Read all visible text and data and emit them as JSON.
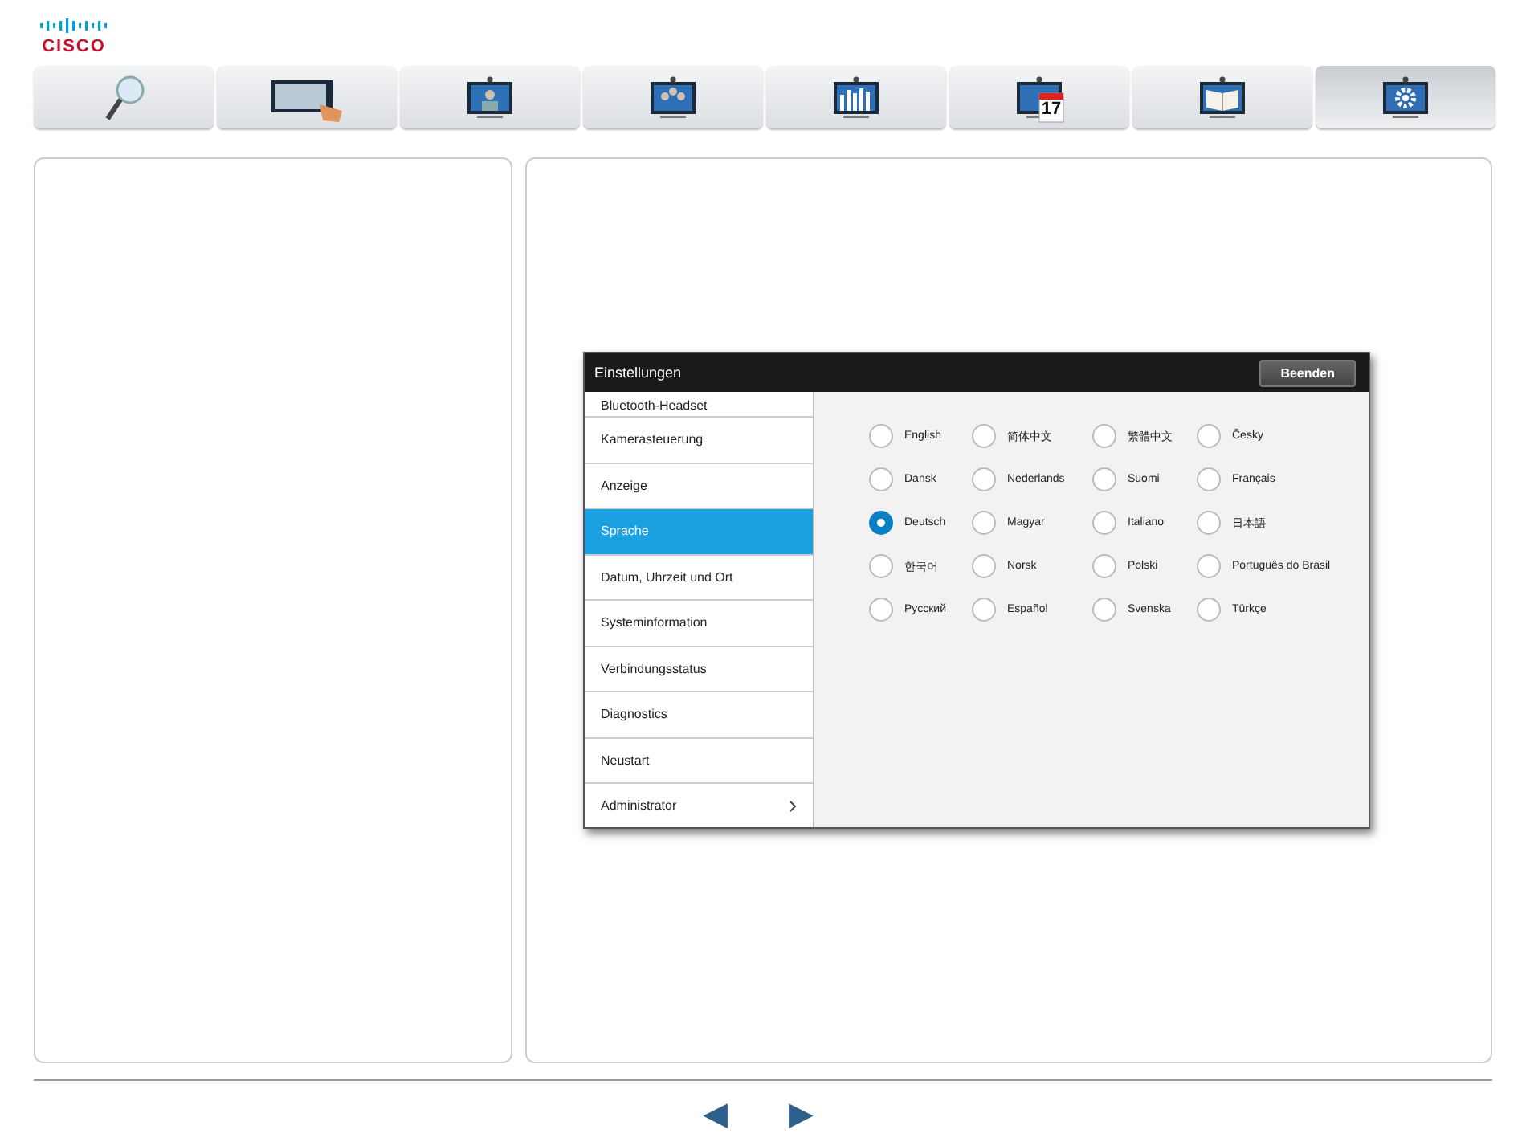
{
  "logo": {
    "wordmark": "CISCO"
  },
  "tabs": [
    {
      "kind": "search",
      "selected": false
    },
    {
      "kind": "touch",
      "selected": false
    },
    {
      "kind": "person",
      "selected": false
    },
    {
      "kind": "group",
      "selected": false
    },
    {
      "kind": "chart",
      "selected": false
    },
    {
      "kind": "calendar",
      "selected": false,
      "badge": "17"
    },
    {
      "kind": "book",
      "selected": false
    },
    {
      "kind": "gear",
      "selected": true
    }
  ],
  "dialog": {
    "title": "Einstellungen",
    "close_button": "Beenden",
    "menu": [
      {
        "label": "Bluetooth-Headset",
        "selected": false
      },
      {
        "label": "Kamerasteuerung",
        "selected": false
      },
      {
        "label": "Anzeige",
        "selected": false
      },
      {
        "label": "Sprache",
        "selected": true
      },
      {
        "label": "Datum, Uhrzeit und Ort",
        "selected": false
      },
      {
        "label": "Systeminformation",
        "selected": false
      },
      {
        "label": "Verbindungsstatus",
        "selected": false
      },
      {
        "label": "Diagnostics",
        "selected": false
      },
      {
        "label": "Neustart",
        "selected": false
      },
      {
        "label": "Administrator",
        "selected": false,
        "submenu": true
      }
    ],
    "languages": [
      {
        "label": "English",
        "selected": false
      },
      {
        "label": "简体中文",
        "selected": false
      },
      {
        "label": "繁體中文",
        "selected": false
      },
      {
        "label": "Česky",
        "selected": false
      },
      {
        "label": "Dansk",
        "selected": false
      },
      {
        "label": "Nederlands",
        "selected": false
      },
      {
        "label": "Suomi",
        "selected": false
      },
      {
        "label": "Français",
        "selected": false
      },
      {
        "label": "Deutsch",
        "selected": true
      },
      {
        "label": "Magyar",
        "selected": false
      },
      {
        "label": "Italiano",
        "selected": false
      },
      {
        "label": "日本語",
        "selected": false
      },
      {
        "label": "한국어",
        "selected": false
      },
      {
        "label": "Norsk",
        "selected": false
      },
      {
        "label": "Polski",
        "selected": false
      },
      {
        "label": "Português do Brasil",
        "selected": false
      },
      {
        "label": "Русский",
        "selected": false
      },
      {
        "label": "Español",
        "selected": false
      },
      {
        "label": "Svenska",
        "selected": false
      },
      {
        "label": "Türkçe",
        "selected": false
      }
    ]
  },
  "pager": {
    "previous": "◀",
    "next": "▶"
  }
}
